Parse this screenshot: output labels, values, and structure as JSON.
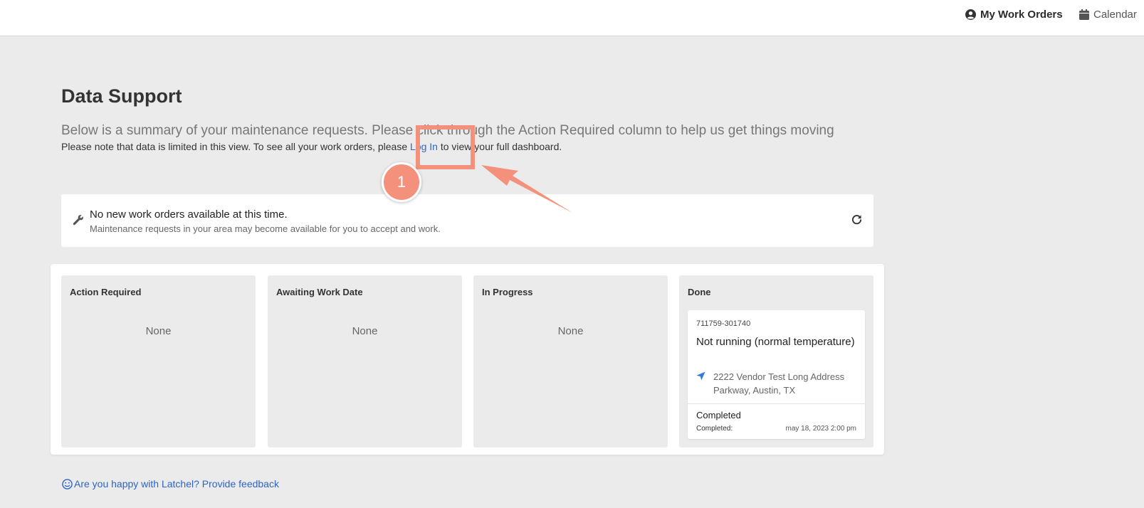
{
  "header": {
    "my_work_orders": "My Work Orders",
    "calendar": "Calendar"
  },
  "page": {
    "title": "Data Support",
    "summary": "Below is a summary of your maintenance requests. Please click through the Action Required column to help us get things moving",
    "note_before": "Please note that data is limited in this view. To see all your work orders, please ",
    "note_link": "Log In",
    "note_after": " to view your full dashboard."
  },
  "notice": {
    "title": "No new work orders available at this time.",
    "subtitle": "Maintenance requests in your area may become available for you to accept and work."
  },
  "board": {
    "columns": [
      {
        "title": "Action Required",
        "empty": "None"
      },
      {
        "title": "Awaiting Work Date",
        "empty": "None"
      },
      {
        "title": "In Progress",
        "empty": "None"
      },
      {
        "title": "Done"
      }
    ],
    "done_card": {
      "id": "711759-301740",
      "title": "Not running (normal temperature)",
      "address": "2222 Vendor Test Long Address Parkway, Austin, TX",
      "status": "Completed",
      "completed_label": "Completed:",
      "completed_date": "may 18, 2023 2:00 pm"
    }
  },
  "feedback": {
    "label": "Are you happy with Latchel? Provide feedback"
  },
  "annotation": {
    "step_number": "1",
    "color": "#f4917c"
  },
  "colors": {
    "link": "#2f64c4",
    "background": "#ebebeb",
    "location_icon": "#2f7be0"
  },
  "icons": {
    "user": "user-circle-icon",
    "calendar": "calendar-icon",
    "wrench": "wrench-icon",
    "refresh": "refresh-icon",
    "location": "location-arrow-icon",
    "smile": "smile-icon"
  }
}
